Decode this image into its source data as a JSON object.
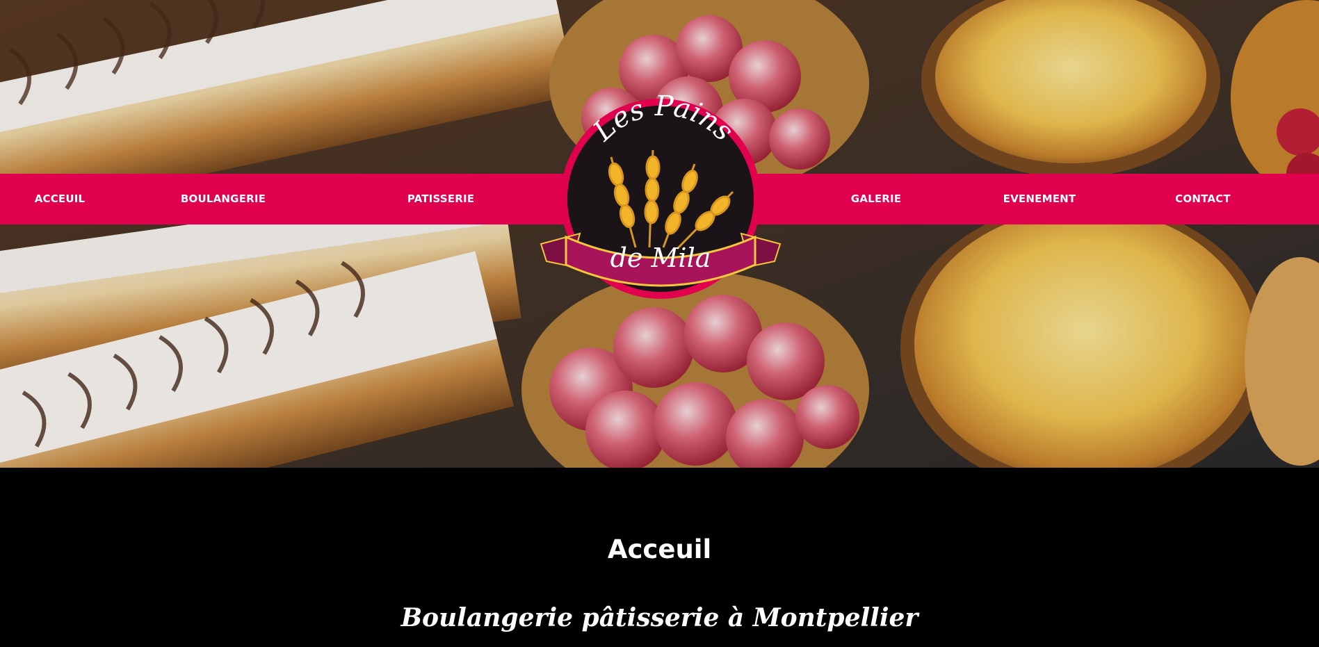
{
  "brand": {
    "logo_text_top": "Les Pains",
    "logo_text_bottom": "de Mila",
    "colors": {
      "accent": "#e1004d",
      "logo_ring": "#e1004d",
      "logo_disc": "#1a1418",
      "ribbon": "#a8145a",
      "ribbon_edge": "#f3c63c",
      "wheat": "#f2b52a",
      "content_bg": "#000000",
      "text": "#ffffff"
    }
  },
  "nav": {
    "items": [
      {
        "label": "ACCEUIL"
      },
      {
        "label": "BOULANGERIE"
      },
      {
        "label": "PATISSERIE"
      },
      {
        "label": "GALERIE"
      },
      {
        "label": "EVENEMENT"
      },
      {
        "label": "CONTACT"
      }
    ]
  },
  "hero": {
    "image_subject": "pastries-photo"
  },
  "content": {
    "title": "Acceuil",
    "tagline": "Boulangerie pâtisserie à Montpellier"
  }
}
